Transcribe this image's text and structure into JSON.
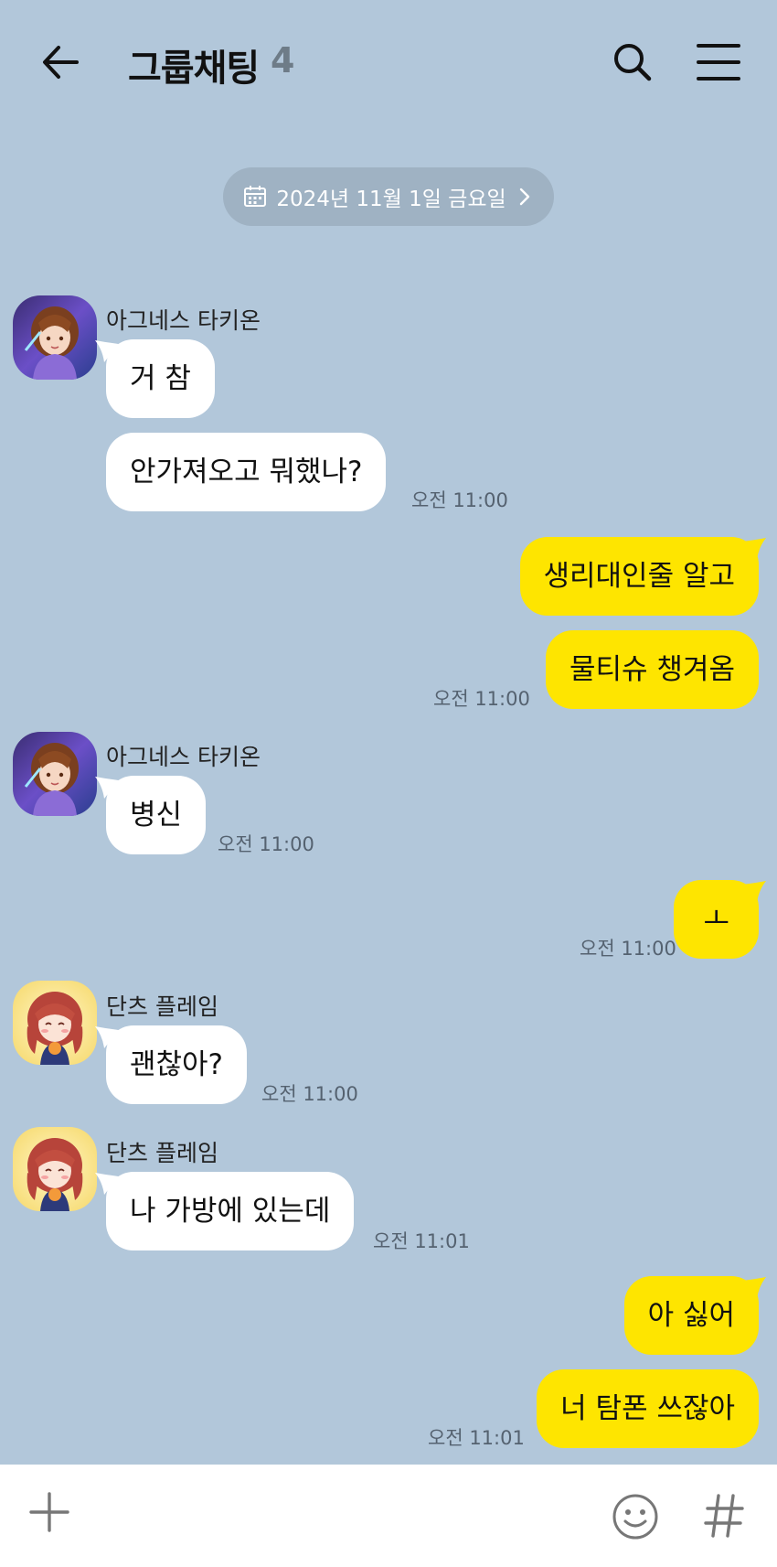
{
  "header": {
    "title": "그룹채팅",
    "member_count": "4",
    "back_icon": "arrow-left-icon",
    "search_icon": "search-icon",
    "menu_icon": "hamburger-menu-icon"
  },
  "date_divider": {
    "label": "2024년 11월 1일 금요일",
    "icon": "calendar-icon",
    "chevron": "chevron-right-icon"
  },
  "colors": {
    "background": "#b2c7da",
    "incoming_bubble": "#ffffff",
    "outgoing_bubble": "#fee500",
    "date_pill": "#9fb2c3"
  },
  "messages": [
    {
      "sender": "아그네스 타키온",
      "avatar": "agnes-tachyon-avatar",
      "direction": "incoming",
      "bubbles": [
        "거 참",
        "안가져오고 뭐했나?"
      ],
      "time": "오전 11:00"
    },
    {
      "direction": "outgoing",
      "bubbles": [
        "생리대인줄 알고",
        "물티슈 챙겨옴"
      ],
      "time": "오전 11:00"
    },
    {
      "sender": "아그네스 타키온",
      "avatar": "agnes-tachyon-avatar",
      "direction": "incoming",
      "bubbles": [
        "병신"
      ],
      "time": "오전 11:00"
    },
    {
      "direction": "outgoing",
      "bubbles": [
        "ㅗ"
      ],
      "time": "오전 11:00"
    },
    {
      "sender": "단츠 플레임",
      "avatar": "dantsu-flame-avatar",
      "direction": "incoming",
      "bubbles": [
        "괜찮아?"
      ],
      "time": "오전 11:00"
    },
    {
      "sender": "단츠 플레임",
      "avatar": "dantsu-flame-avatar",
      "direction": "incoming",
      "bubbles": [
        "나 가방에 있는데"
      ],
      "time": "오전 11:01"
    },
    {
      "direction": "outgoing",
      "bubbles": [
        "아 싫어",
        "너 탐폰 쓰잖아"
      ],
      "time": "오전 11:01"
    }
  ],
  "bottom_bar": {
    "plus_icon": "plus-icon",
    "emoji_icon": "smiley-icon",
    "hash_icon": "hash-icon"
  }
}
